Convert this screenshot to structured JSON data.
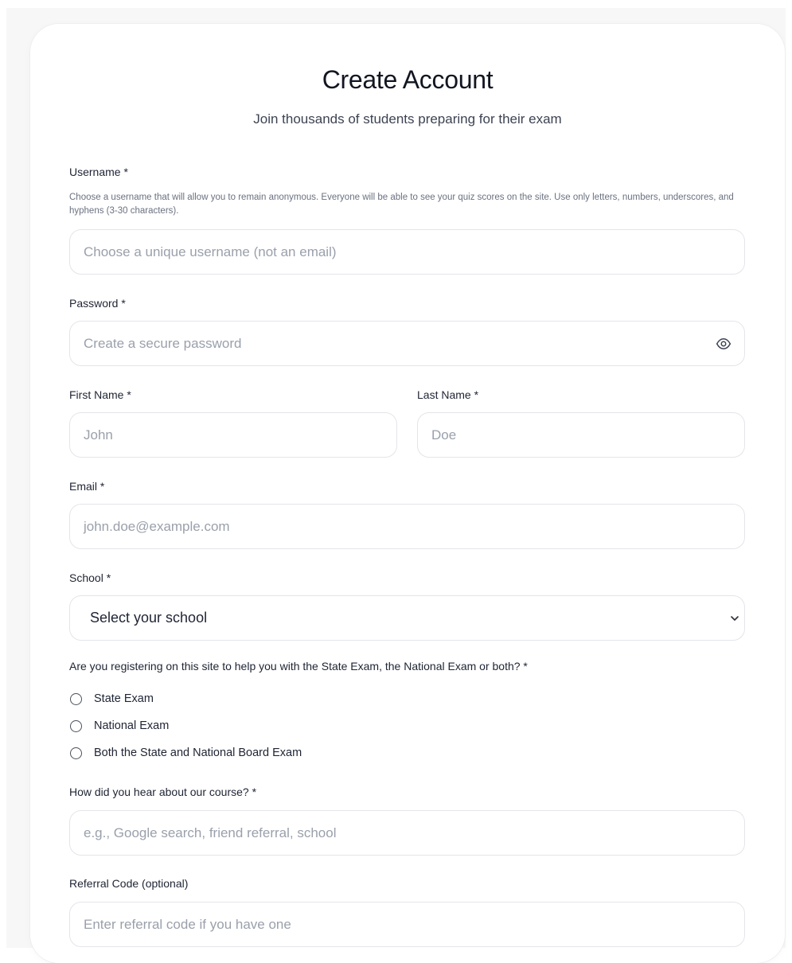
{
  "header": {
    "title": "Create Account",
    "subtitle": "Join thousands of students preparing for their exam"
  },
  "username": {
    "label": "Username *",
    "hint": "Choose a username that will allow you to remain anonymous. Everyone will be able to see your quiz scores on the site. Use only letters, numbers, underscores, and hyphens (3-30 characters).",
    "placeholder": "Choose a unique username (not an email)"
  },
  "password": {
    "label": "Password *",
    "placeholder": "Create a secure password",
    "toggle_icon": "eye-icon"
  },
  "first_name": {
    "label": "First Name *",
    "placeholder": "John"
  },
  "last_name": {
    "label": "Last Name *",
    "placeholder": "Doe"
  },
  "email": {
    "label": "Email *",
    "placeholder": "john.doe@example.com"
  },
  "school": {
    "label": "School *",
    "selected": "Select your school",
    "icon": "chevron-down-icon"
  },
  "exam_question": {
    "label": "Are you registering on this site to help you with the State Exam, the National Exam or both? *",
    "options": [
      {
        "label": "State Exam",
        "checked": false
      },
      {
        "label": "National Exam",
        "checked": false
      },
      {
        "label": "Both the State and National Board Exam",
        "checked": false
      }
    ]
  },
  "hear_about": {
    "label": "How did you hear about our course? *",
    "placeholder": "e.g., Google search, friend referral, school"
  },
  "referral": {
    "label": "Referral Code (optional)",
    "placeholder": "Enter referral code if you have one"
  },
  "colors": {
    "border": "#e3e5ea",
    "text": "#1f2433",
    "placeholder": "#9aa0ab",
    "hint": "#6b7180"
  }
}
